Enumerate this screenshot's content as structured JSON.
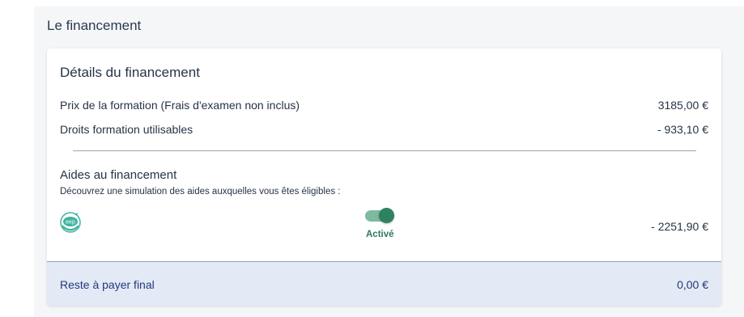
{
  "section": {
    "title": "Le financement"
  },
  "card": {
    "title": "Détails du financement",
    "price": {
      "label": "Prix de la formation (Frais d'examen non inclus)",
      "value": "3185,00 €"
    },
    "rights": {
      "label": "Droits formation utilisables",
      "value": "- 933,10 €"
    },
    "aid": {
      "title": "Aides au financement",
      "subtitle": "Découvrez une simulation des aides auxquelles vous êtes éligibles :",
      "logo_text": "eep",
      "toggle_label": "Activé",
      "toggle_on": true,
      "amount": "- 2251,90 €"
    },
    "final": {
      "label": "Reste à payer final",
      "value": "0,00 €"
    }
  },
  "colors": {
    "accent_green": "#2e8260",
    "footer_bg": "#e4e9f6",
    "footer_text": "#1f3a78"
  }
}
